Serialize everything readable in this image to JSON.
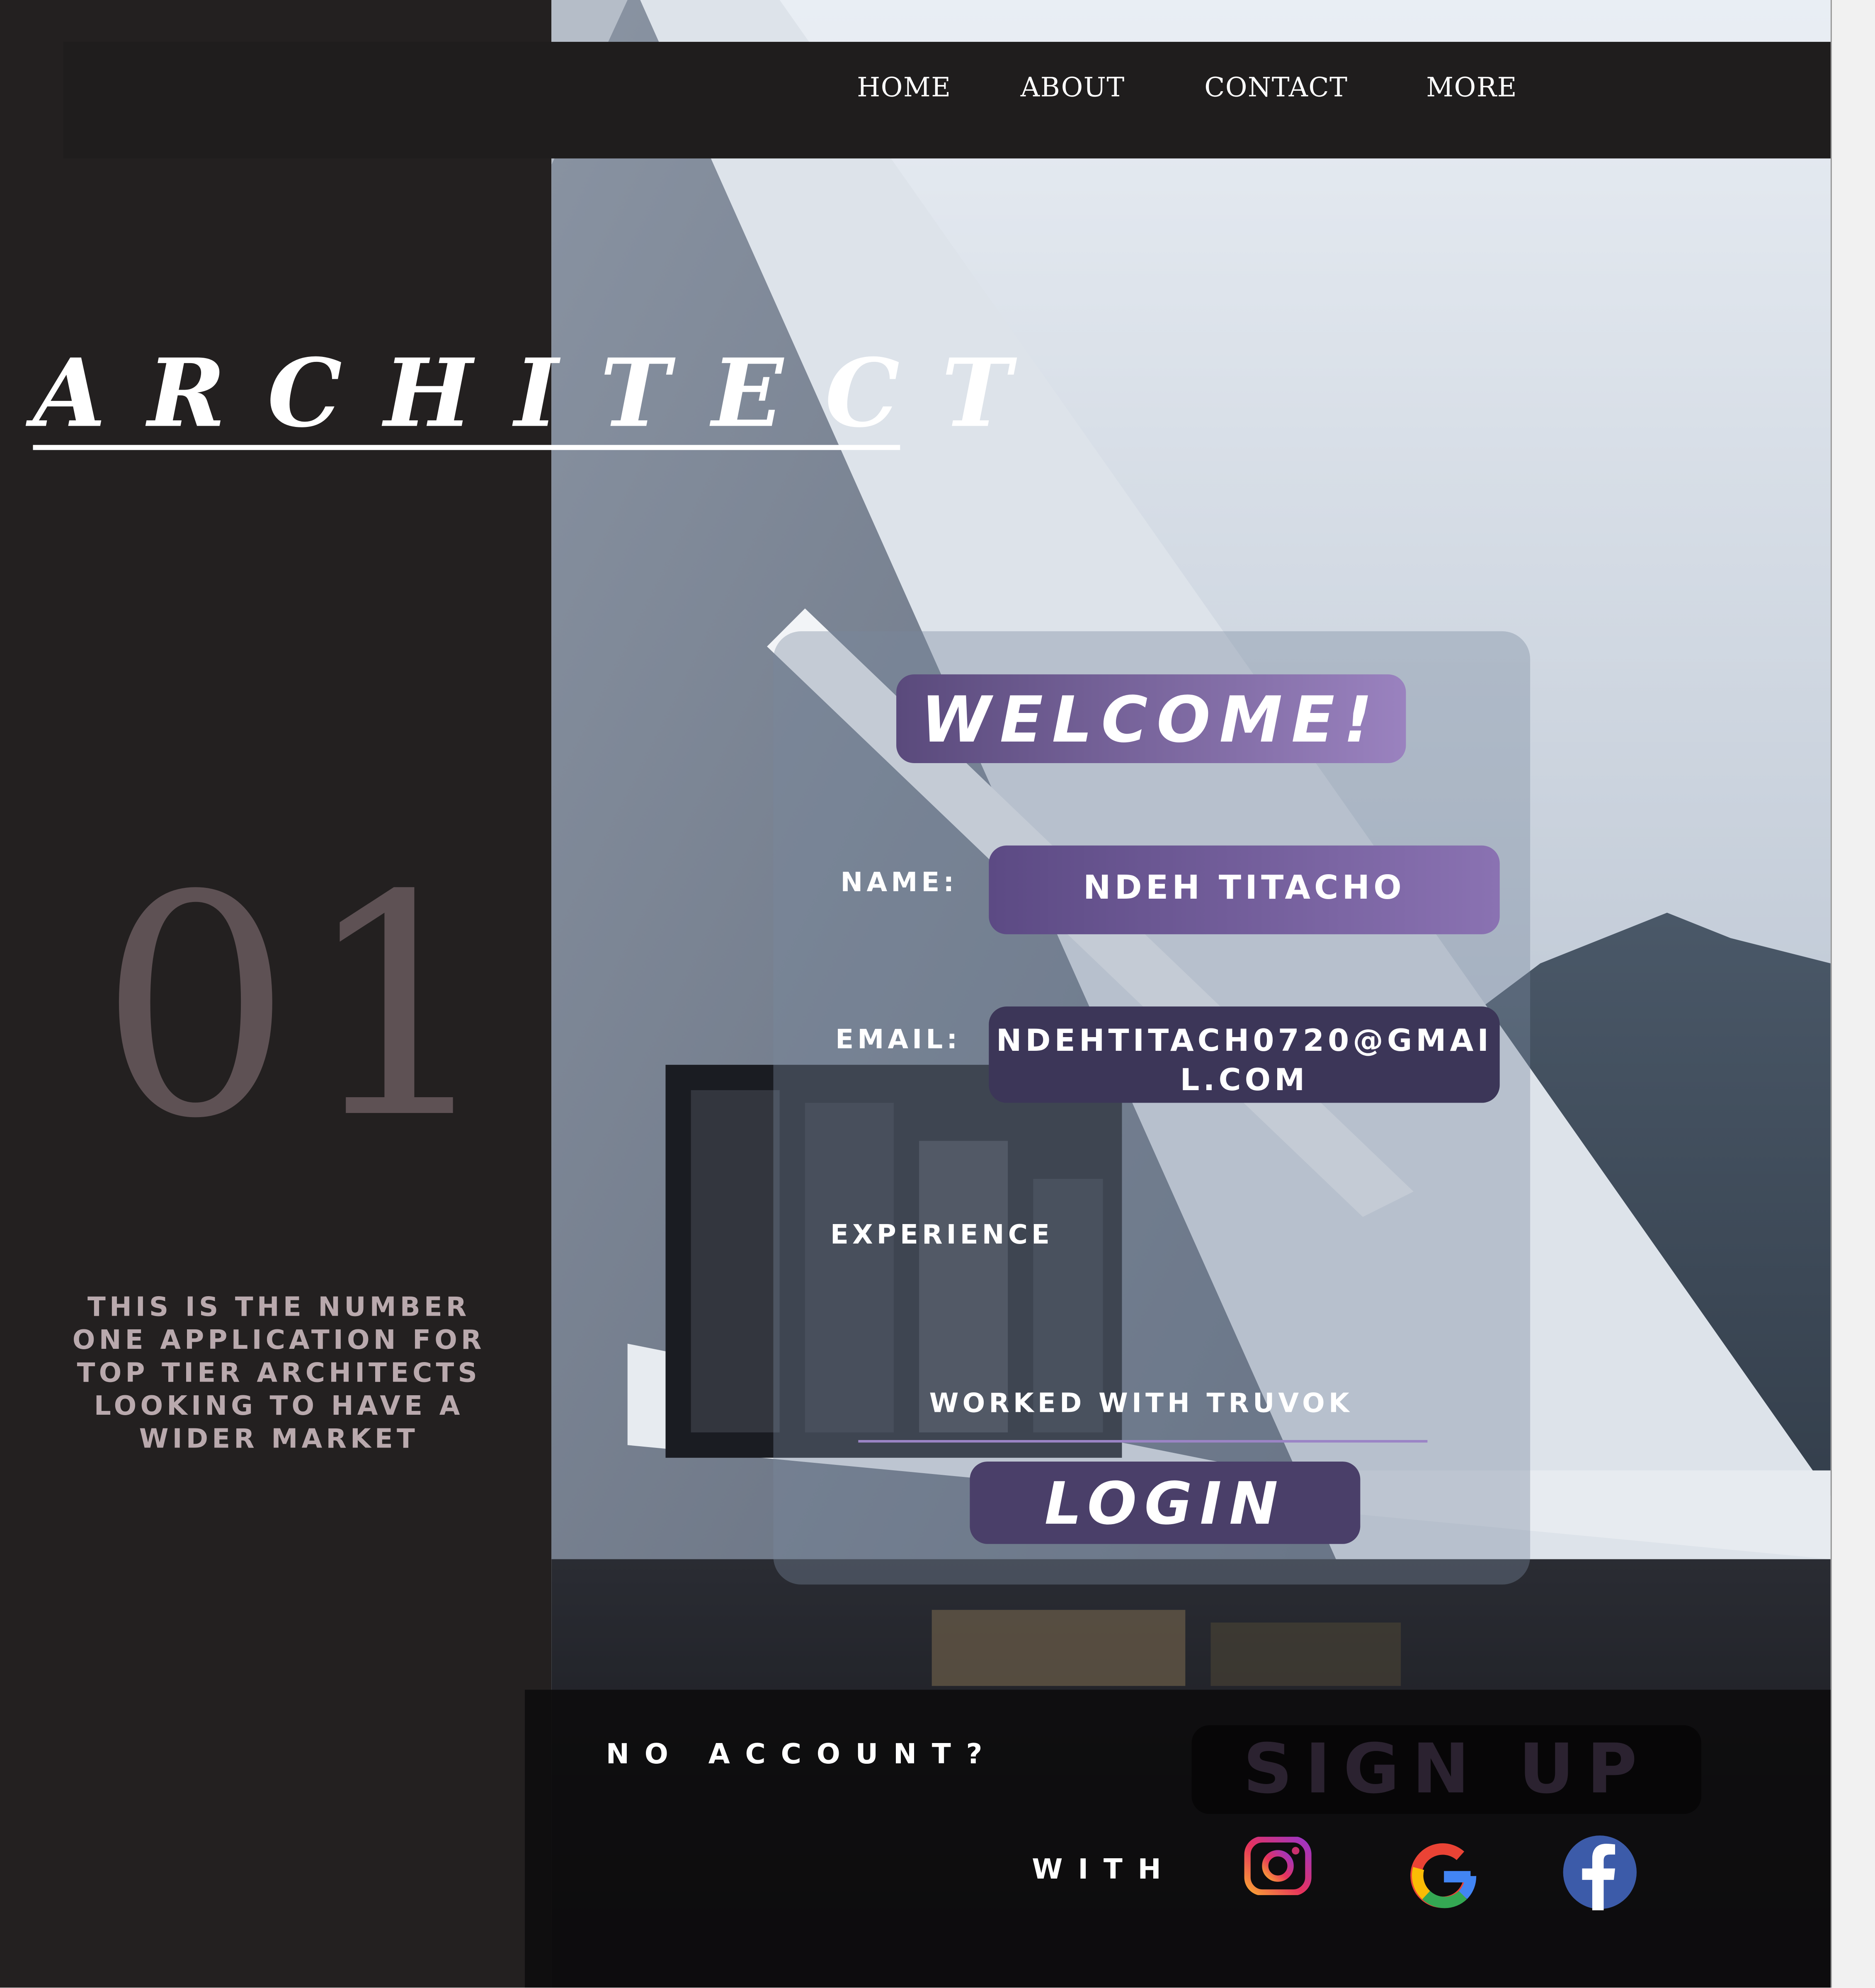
{
  "nav": {
    "items": [
      {
        "label": "HOME"
      },
      {
        "label": "ABOUT"
      },
      {
        "label": "CONTACT"
      },
      {
        "label": "MORE"
      }
    ]
  },
  "hero": {
    "title": "ARCHITECT",
    "number": "01",
    "tagline": "THIS IS THE NUMBER ONE APPLICATION FOR TOP TIER ARCHITECTS LOOKING TO HAVE A WIDER MARKET"
  },
  "form": {
    "welcome": "WELCOME!",
    "name_label": "NAME:",
    "name_value": "NDEH TITACHO",
    "email_label": "EMAIL:",
    "email_value": "NDEHTITACH0720@GMAIL.COM",
    "experience_label": "EXPERIENCE",
    "experience_value": "WORKED WITH TRUVOK",
    "login_label": "LOGIN"
  },
  "footer": {
    "no_account": "NO ACCOUNT?",
    "signup_label": "SIGN UP",
    "with_label": "WITH",
    "social_icons": [
      "instagram-icon",
      "google-icon",
      "facebook-icon"
    ]
  },
  "colors": {
    "panel": "#232020",
    "navbar": "#1f1d1d",
    "accent_purple": "#9a82bf",
    "number": "#5e5154",
    "tagline": "#b9a9ad",
    "login": "#4a3f69"
  }
}
